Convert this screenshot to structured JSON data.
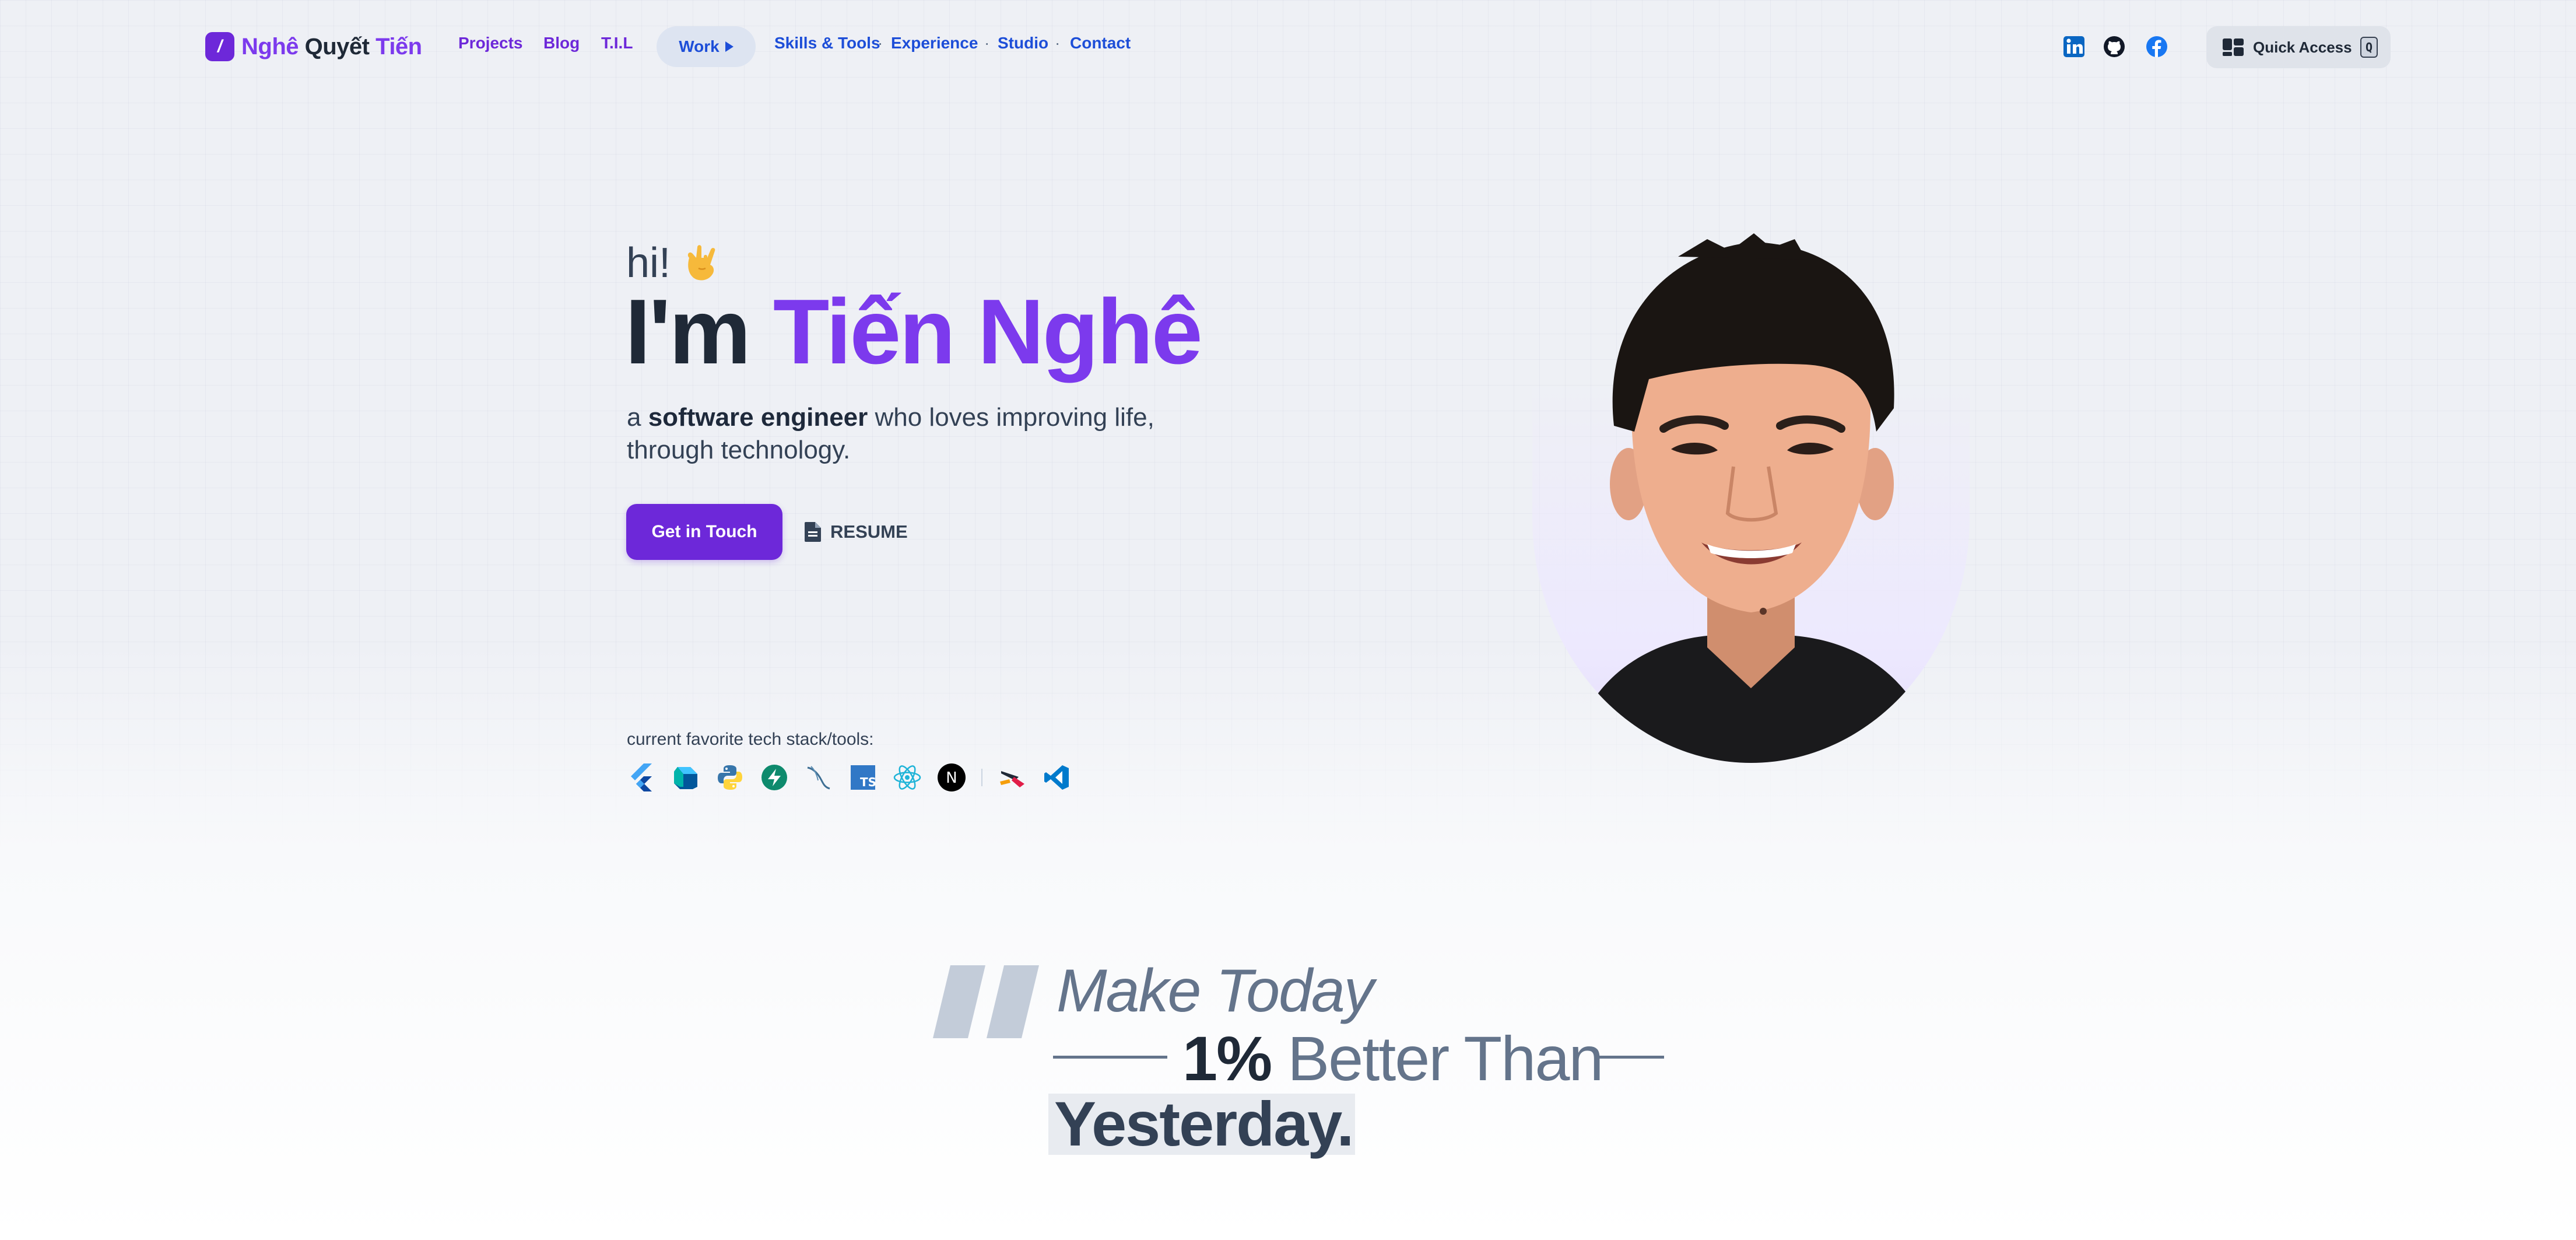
{
  "logo": {
    "mark": "/",
    "part1": "Nghê",
    "part2": "Quyết",
    "part3": "Tiến"
  },
  "nav": {
    "projects": "Projects",
    "blog": "Blog",
    "til": "T.I.L",
    "work": "Work",
    "skills": "Skills & Tools",
    "experience": "Experience",
    "studio": "Studio",
    "contact": "Contact",
    "dot": "·"
  },
  "social": {
    "icons": [
      "linkedin-icon",
      "github-icon",
      "facebook-icon"
    ]
  },
  "quick_access": {
    "label": "Quick Access",
    "key": "Q"
  },
  "hero": {
    "greeting": "hi!",
    "title_prefix": "I'm",
    "name": "Tiến Nghê",
    "tagline_pre": "a ",
    "tagline_bold": "software engineer",
    "tagline_post": " who loves improving life, through technology.",
    "cta": "Get in Touch",
    "resume": "RESUME"
  },
  "stack": {
    "label": "current favorite tech stack/tools:",
    "icons": [
      "flutter-icon",
      "dart-icon",
      "python-icon",
      "supabase-icon",
      "mysql-icon",
      "typescript-icon",
      "react-icon",
      "nextjs-icon",
      "tool-icon",
      "vscode-icon"
    ],
    "ts_text": "TS",
    "next_text": "N"
  },
  "quote": {
    "line1": "Make Today",
    "line2_bold": "1%",
    "line2_rest": " Better Than",
    "line3": "Yesterday."
  },
  "colors": {
    "accent": "#7c3aed",
    "link": "#1d4ed8",
    "text": "#1f2937",
    "muted": "#64748b"
  }
}
